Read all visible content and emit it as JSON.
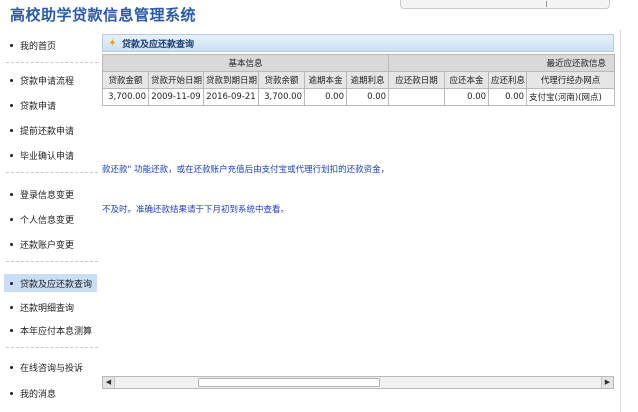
{
  "app": {
    "title": "高校助学贷款信息管理系统"
  },
  "sidebar": {
    "items": [
      {
        "label": "我的首页",
        "active": false
      },
      {
        "label": "贷款申请流程",
        "active": false
      },
      {
        "label": "贷款申请",
        "active": false
      },
      {
        "label": "提前还款申请",
        "active": false
      },
      {
        "label": "毕业确认申请",
        "active": false
      },
      {
        "label": "登录信息变更",
        "active": false
      },
      {
        "label": "个人信息变更",
        "active": false
      },
      {
        "label": "还款账户变更",
        "active": false
      },
      {
        "label": "贷款及应还款查询",
        "active": true
      },
      {
        "label": "还款明细查询",
        "active": false
      },
      {
        "label": "本年应付本息测算",
        "active": false
      },
      {
        "label": "在线咨询与投诉",
        "active": false
      },
      {
        "label": "我的消息",
        "active": false
      }
    ]
  },
  "section": {
    "title": "贷款及应还款查询",
    "icon": "star-icon"
  },
  "table": {
    "group_headers": [
      "基本信息",
      "最近应还款信息"
    ],
    "columns": [
      "贷款金额",
      "贷款开始日期",
      "贷款到期日期",
      "贷款余额",
      "逾期本金",
      "逾期利息",
      "应还款日期",
      "应还本金",
      "应还利息",
      "代理行经办网点"
    ],
    "rows": [
      [
        "3,700.00",
        "2009-11-09",
        "2016-09-21",
        "3,700.00",
        "0.00",
        "0.00",
        "",
        "0.00",
        "0.00",
        "支付宝(河南)(网点)"
      ]
    ]
  },
  "notes": [
    "款还款\" 功能还款，或在还款账户充值后由支付宝或代理行划扣的还款资金，",
    "不及时。准确还款结果请于下月初到系统中查看。"
  ]
}
